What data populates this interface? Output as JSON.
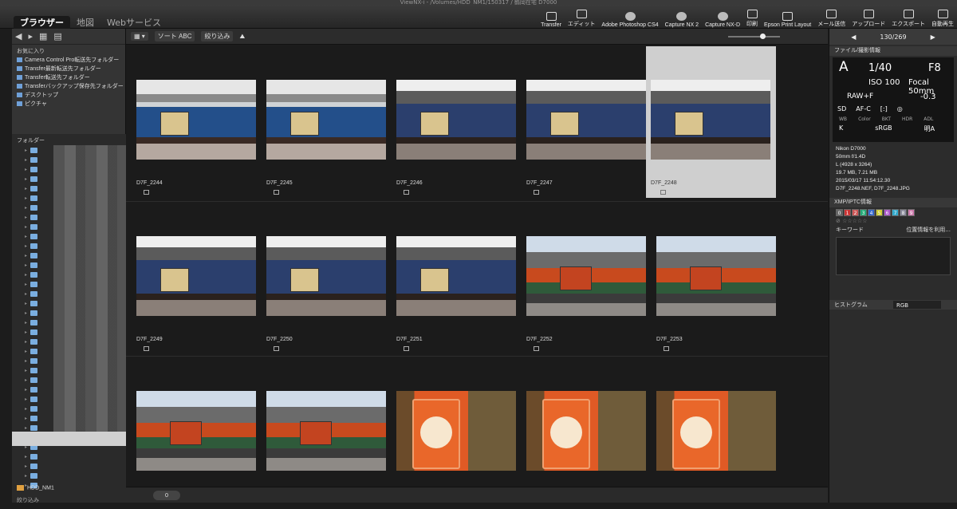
{
  "titlebar": "ViewNX-i - /Volumes/HDD_NM1/150317 / 鶴岡在宅 D7000",
  "tabs": [
    "ブラウザー",
    "地図",
    "Webサービス"
  ],
  "tools": [
    "Transfer",
    "エディット",
    "Adobe Photoshop CS4",
    "Capture NX 2",
    "Capture NX-D",
    "印刷",
    "Epson Print Layout",
    "メール送信",
    "アップロード",
    "エクスポート",
    "自動再生"
  ],
  "left": {
    "favorites_header": "お気に入り",
    "favorites": [
      "Camera Control Pro転送先フォルダー",
      "Transfer最新転送先フォルダー",
      "Transfer転送先フォルダー",
      "Transferバックアップ保存先フォルダー",
      "デスクトップ",
      "ピクチャ"
    ],
    "folders_header": "フォルダー",
    "hdd": "HDD_NM1",
    "footer": "絞り込み"
  },
  "center": {
    "sort_label": "ソート ABC",
    "filter_label": "絞り込み",
    "count": "0",
    "thumbs": [
      {
        "name": "D7F_2244",
        "kind": "train-blue"
      },
      {
        "name": "D7F_2245",
        "kind": "train-blue"
      },
      {
        "name": "D7F_2246",
        "kind": "train-dark"
      },
      {
        "name": "D7F_2247",
        "kind": "train-dark"
      },
      {
        "name": "D7F_2248",
        "kind": "train-dark"
      },
      {
        "name": "D7F_2249",
        "kind": "train-dark"
      },
      {
        "name": "D7F_2250",
        "kind": "train-dark"
      },
      {
        "name": "D7F_2251",
        "kind": "train-dark"
      },
      {
        "name": "D7F_2252",
        "kind": "train-orange"
      },
      {
        "name": "D7F_2253",
        "kind": "train-orange"
      },
      {
        "name": "",
        "kind": "train-orange"
      },
      {
        "name": "",
        "kind": "train-orange"
      },
      {
        "name": "",
        "kind": "snack"
      },
      {
        "name": "",
        "kind": "snack"
      },
      {
        "name": "",
        "kind": "snack"
      }
    ]
  },
  "right": {
    "nav": "130/269",
    "panel_title": "ファイル/撮影情報",
    "mode": "A",
    "shutter": "1/40",
    "aperture": "F8",
    "iso": "ISO 100",
    "focal": "Focal 50mm",
    "quality": "RAW+F",
    "ev": "-0.3",
    "row3": [
      "SD",
      "AF-C",
      "[:]",
      "◎"
    ],
    "row4": [
      "WB",
      "Color",
      "BKT",
      "HDR",
      "ADL"
    ],
    "row5": [
      "K",
      "sRGB",
      "明A"
    ],
    "info": [
      "Nikon D7000",
      "50mm f/1.4D",
      "L (4928 x 3264)",
      "19.7 MB, 7.21 MB",
      "2015/03/17 11:54:12.30",
      "D7F_2248.NEF, D7F_2248.JPG"
    ],
    "xmp_title": "XMP/IPTC情報",
    "labels": [
      "0",
      "1",
      "2",
      "3",
      "4",
      "5",
      "6",
      "7",
      "8",
      "9"
    ],
    "label_colors": [
      "#666",
      "#c33",
      "#c55",
      "#2a7",
      "#36c",
      "#cc3",
      "#a5c",
      "#3ac",
      "#889",
      "#c7a"
    ],
    "keyword_label": "キーワード",
    "keyword_hint": "位置情報を利用...",
    "histogram": "ヒストグラム",
    "histogram_mode": "RGB"
  }
}
